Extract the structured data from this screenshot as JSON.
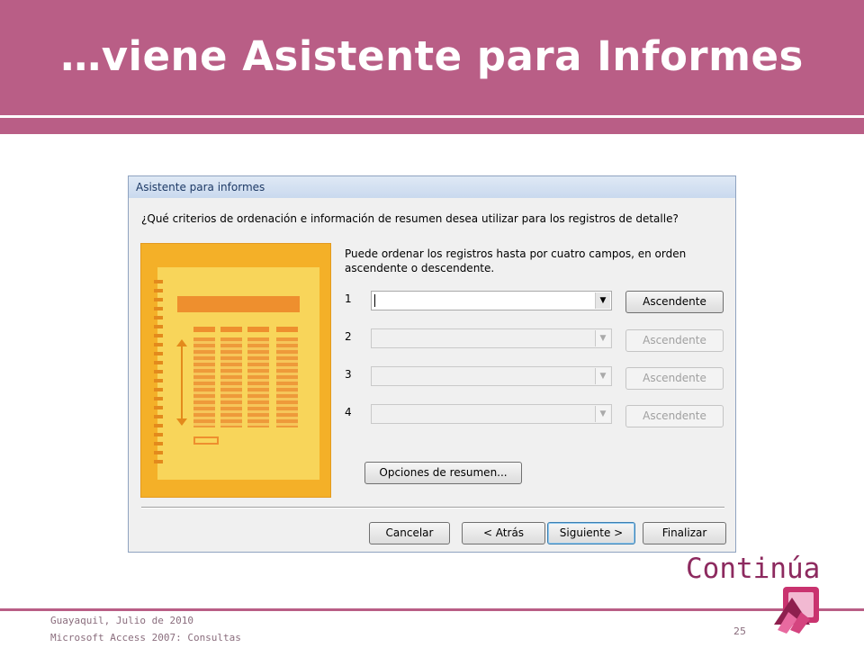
{
  "slide": {
    "title": "…viene Asistente para Informes",
    "continue_label": "Continúa",
    "footer_line1": "Guayaquil, Julio de 2010",
    "footer_line2": "Microsoft Access 2007: Consultas",
    "page_number": "25"
  },
  "dialog": {
    "title": "Asistente para informes",
    "question": "¿Qué criterios de ordenación e información de resumen desea utilizar para los registros de detalle?",
    "instructions": "Puede ordenar los registros hasta por cuatro campos, en orden ascendente o descendente.",
    "sort_rows": [
      {
        "num": "1",
        "value": "",
        "order_label": "Ascendente",
        "enabled": true
      },
      {
        "num": "2",
        "value": "",
        "order_label": "Ascendente",
        "enabled": false
      },
      {
        "num": "3",
        "value": "",
        "order_label": "Ascendente",
        "enabled": false
      },
      {
        "num": "4",
        "value": "",
        "order_label": "Ascendente",
        "enabled": false
      }
    ],
    "summary_button": "Opciones de resumen...",
    "buttons": {
      "cancel": "Cancelar",
      "back": "< Atrás",
      "next": "Siguiente >",
      "finish": "Finalizar"
    }
  },
  "colors": {
    "accent": "#b95e86",
    "continue_text": "#8d2a5f",
    "illustration": "#f4b028"
  },
  "icons": [
    "dropdown-arrow-icon",
    "report-illustration",
    "access-logo-icon"
  ]
}
